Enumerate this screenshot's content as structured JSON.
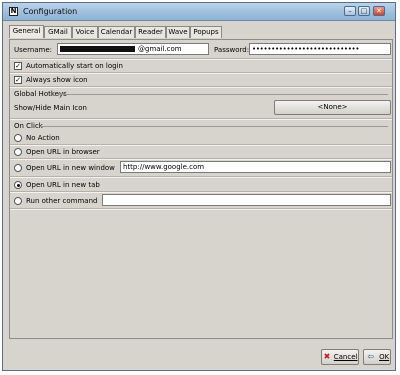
{
  "window": {
    "title": "Configuration",
    "icon_letter": "N",
    "controls": {
      "minimize": "–",
      "maximize": "□",
      "close": "✕"
    }
  },
  "tabs": [
    {
      "label": "General",
      "active": true
    },
    {
      "label": "GMail"
    },
    {
      "label": "Voice"
    },
    {
      "label": "Calendar"
    },
    {
      "label": "Reader"
    },
    {
      "label": "Wave"
    },
    {
      "label": "Popups"
    }
  ],
  "account": {
    "username_label": "Username:",
    "username_value": "@gmail.com",
    "password_label": "Password:",
    "password_value": "••••••••••••••••••••••••••••"
  },
  "options": {
    "auto_start": {
      "label": "Automatically start on login",
      "checked": true
    },
    "always_show_icon": {
      "label": "Always show icon",
      "checked": true
    }
  },
  "hotkeys": {
    "section_label": "Global Hotkeys",
    "show_hide_label": "Show/Hide Main Icon",
    "show_hide_value": "<None>"
  },
  "on_click": {
    "section_label": "On Click",
    "options": [
      {
        "label": "No Action",
        "selected": false
      },
      {
        "label": "Open URL in browser",
        "selected": false
      },
      {
        "label": "Open URL in new window",
        "selected": false,
        "field": "http://www.google.com"
      },
      {
        "label": "Open URL in new tab",
        "selected": true
      },
      {
        "label": "Run other command",
        "selected": false,
        "field": ""
      }
    ]
  },
  "footer": {
    "cancel_label": "Cancel",
    "ok_label": "OK"
  },
  "colors": {
    "title_gradient_top": "#b9d3ea",
    "window_bg": "#d7d4cd",
    "cancel_icon": "#c71d1d",
    "ok_icon": "#3b6fb2"
  }
}
